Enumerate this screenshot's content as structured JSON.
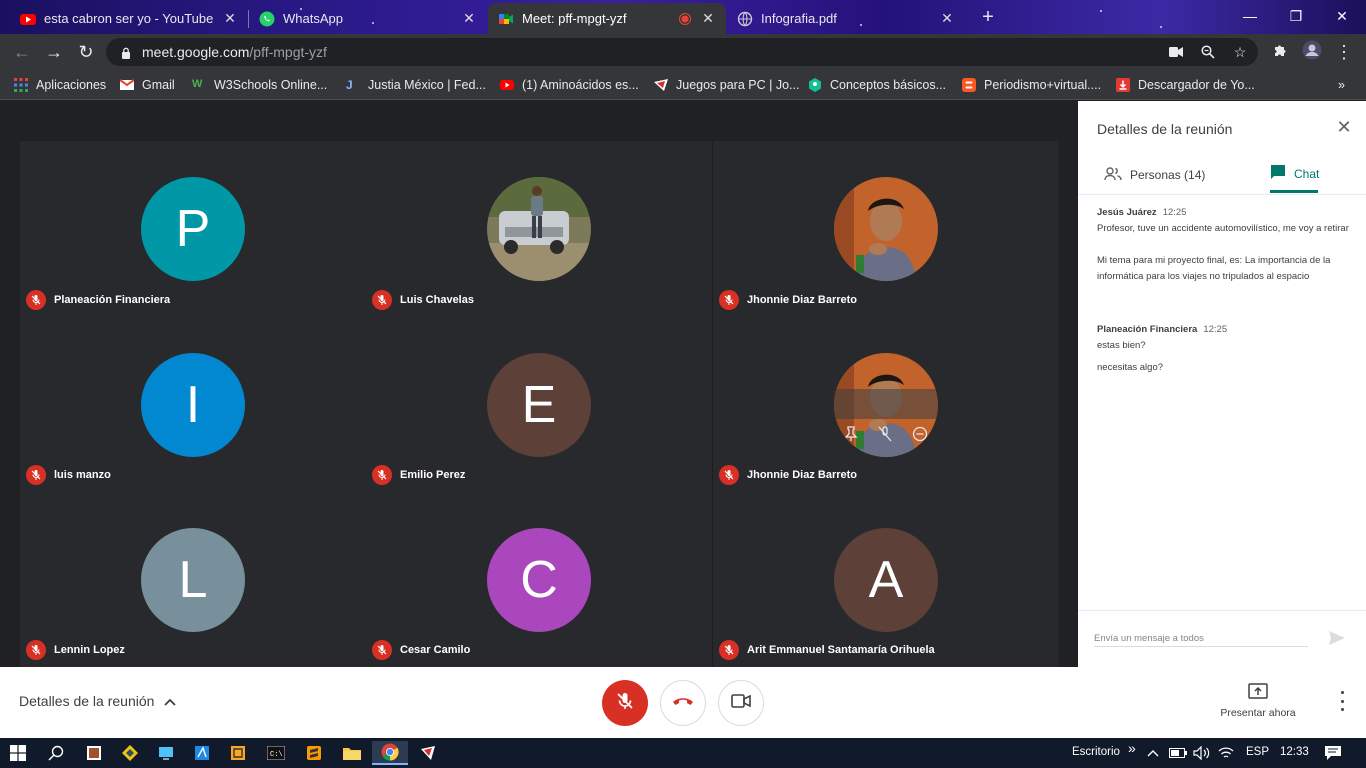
{
  "browser": {
    "tabs": [
      {
        "title": "esta cabron ser yo - YouTube",
        "favicon": "youtube-icon"
      },
      {
        "title": "WhatsApp",
        "favicon": "whatsapp-icon"
      },
      {
        "title": "Meet: pff-mpgt-yzf",
        "favicon": "google-meet-icon",
        "active": true
      },
      {
        "title": "Infografia.pdf",
        "favicon": "globe-icon"
      }
    ],
    "new_tab": "+",
    "address": {
      "host": "meet.google.com",
      "path": "/pff-mpgt-yzf"
    }
  },
  "bookmarks": [
    {
      "label": "Aplicaciones",
      "icon": "apps-grid-icon"
    },
    {
      "label": "Gmail",
      "icon": "gmail-icon"
    },
    {
      "label": "W3Schools Online...",
      "icon": "w3schools-icon"
    },
    {
      "label": "Justia México | Fed...",
      "icon": "justia-icon"
    },
    {
      "label": "(1) Aminoácidos es...",
      "icon": "youtube-icon"
    },
    {
      "label": "Juegos para PC | Jo...",
      "icon": "games-icon"
    },
    {
      "label": "Conceptos básicos...",
      "icon": "khan-icon"
    },
    {
      "label": "Periodismo+virtual....",
      "icon": "blogger-icon"
    },
    {
      "label": "Descargador de Yo...",
      "icon": "download-icon"
    }
  ],
  "participants": [
    {
      "name": "Planeación Financiera",
      "initial": "P",
      "color": "#0097a7",
      "photo": false
    },
    {
      "name": "Luis Chavelas",
      "initial": "",
      "color": "#8a8f7a",
      "photo": true
    },
    {
      "name": "Jhonnie Diaz Barreto",
      "initial": "",
      "color": "#c0622c",
      "photo": true
    },
    {
      "name": "luis manzo",
      "initial": "I",
      "color": "#0288d1",
      "photo": false
    },
    {
      "name": "Emilio Perez",
      "initial": "E",
      "color": "#5d4037",
      "photo": false
    },
    {
      "name": "Jhonnie Diaz Barreto",
      "initial": "",
      "color": "#c0622c",
      "photo": true
    },
    {
      "name": "Lennin Lopez",
      "initial": "L",
      "color": "#78909c",
      "photo": false
    },
    {
      "name": "Cesar Camilo",
      "initial": "C",
      "color": "#ab47bc",
      "photo": false
    },
    {
      "name": "Arit Emmanuel Santamaría Orihuela",
      "initial": "A",
      "color": "#5d4037",
      "photo": false
    }
  ],
  "panel": {
    "title": "Detalles de la reunión",
    "tab_people": "Personas (14)",
    "tab_chat": "Chat",
    "messages": [
      {
        "sender": "Jesús Juárez",
        "time": "12:25",
        "lines": [
          "Profesor, tuve un accidente automovilístico, me voy a retirar",
          "Mi tema para mi proyecto final, es: La importancia de la informática para los viajes no tripulados al espacio"
        ]
      },
      {
        "sender": "Planeación Financiera",
        "time": "12:25",
        "lines": [
          "estas bien?",
          "necesitas algo?"
        ]
      }
    ],
    "input_placeholder": "Envía un mensaje a todos"
  },
  "controls": {
    "details_label": "Detalles de la reunión",
    "present_label": "Presentar ahora"
  },
  "taskbar": {
    "desktop_label": "Escritorio",
    "language": "ESP",
    "clock": "12:33"
  }
}
